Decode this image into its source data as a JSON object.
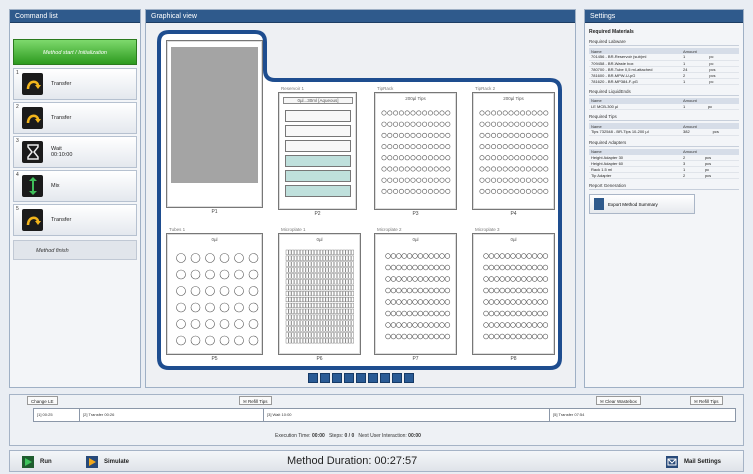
{
  "panels": {
    "command_list": "Command list",
    "graphical_view": "Graphical view",
    "settings": "Settings"
  },
  "commands": {
    "start": "Method start / Initialization",
    "items": [
      {
        "num": "1",
        "label": "Transfer",
        "sub": "",
        "icon": "transfer-icon"
      },
      {
        "num": "2",
        "label": "Transfer",
        "sub": "",
        "icon": "transfer-icon"
      },
      {
        "num": "3",
        "label": "Wait",
        "sub": "00:10:00",
        "icon": "hourglass-icon"
      },
      {
        "num": "4",
        "label": "Mix",
        "sub": "",
        "icon": "mix-icon"
      },
      {
        "num": "5",
        "label": "Transfer",
        "sub": "",
        "icon": "transfer-icon"
      }
    ],
    "finish": "Method finish"
  },
  "deck": {
    "p1": "P1",
    "p2": "P2",
    "p2_title": "Reservoir 1",
    "p2_sub": "0µl...30ml [Aqueous]",
    "p3": "P3",
    "p3_title": "TipRack",
    "p3_sub": "200µl Tips",
    "p4": "P4",
    "p4_title": "TipRack 2",
    "p4_sub": "200µl Tips",
    "p5": "P5",
    "p5_title": "Tubes 1",
    "p5_sub": "0µl",
    "p6": "P6",
    "p6_title": "Microplate 1",
    "p6_sub": "0µl",
    "p7": "P7",
    "p7_title": "Microplate 2",
    "p7_sub": "0µl",
    "p8": "P8",
    "p8_title": "Microplate 3",
    "p8_sub": "0µl"
  },
  "settings": {
    "required_materials": "Required Materials",
    "labware_title": "Required Labware",
    "col_name": "Name",
    "col_amount": "Amount",
    "labware": [
      [
        "701456 - BR-Reservoir (sub)ml",
        "1",
        "pc"
      ],
      [
        "709458 - BR-Waste box",
        "1",
        "pc"
      ],
      [
        "780700 - BR-Tube 0,5 ml-attached",
        "24",
        "pcs"
      ],
      [
        "781600 - BR-MPW-U-pG",
        "2",
        "pcs"
      ],
      [
        "781620 - BR-MP384-F-pG",
        "1",
        "pc"
      ]
    ],
    "liquid_title": "Required LiquidEnds",
    "liquids": [
      [
        "LE MCB-300 µl",
        "1",
        "pc"
      ]
    ],
    "tips_title": "Required Tips",
    "tips": [
      [
        "Tips 732548 - BR-Tips 10-200 µl",
        "382",
        "pcs"
      ]
    ],
    "adapters_title": "Required Adapters",
    "adapters": [
      [
        "Height Adapter 30",
        "2",
        "pcs"
      ],
      [
        "Height Adapter 60",
        "3",
        "pcs"
      ],
      [
        "Rack 1.5 ml",
        "1",
        "pc"
      ],
      [
        "Tip Adapter",
        "2",
        "pcs"
      ]
    ],
    "report_title": "Report Generation",
    "report_button": "Export Method Summary"
  },
  "timeline": {
    "change_le": "Change LE",
    "refill_tips_1": "Refill Tips",
    "clear_wastebox": "Clear Wastebox",
    "refill_tips_2": "Refill Tips",
    "seg1": "[1] 00:25",
    "seg2": "[2] Transfer 00:26",
    "seg3": "[3] Wait 10:00",
    "seg4": "[5] Transfer 07:54",
    "exec_label": "Execution Time:",
    "exec_value": "00:00",
    "steps_label": "Steps:",
    "steps_value": "0 / 0",
    "next_label": "Next User Interaction:",
    "next_value": "00:00"
  },
  "bottom": {
    "run": "Run",
    "simulate": "Simulate",
    "duration": "Method Duration: 00:27:57",
    "mail": "Mail Settings"
  }
}
